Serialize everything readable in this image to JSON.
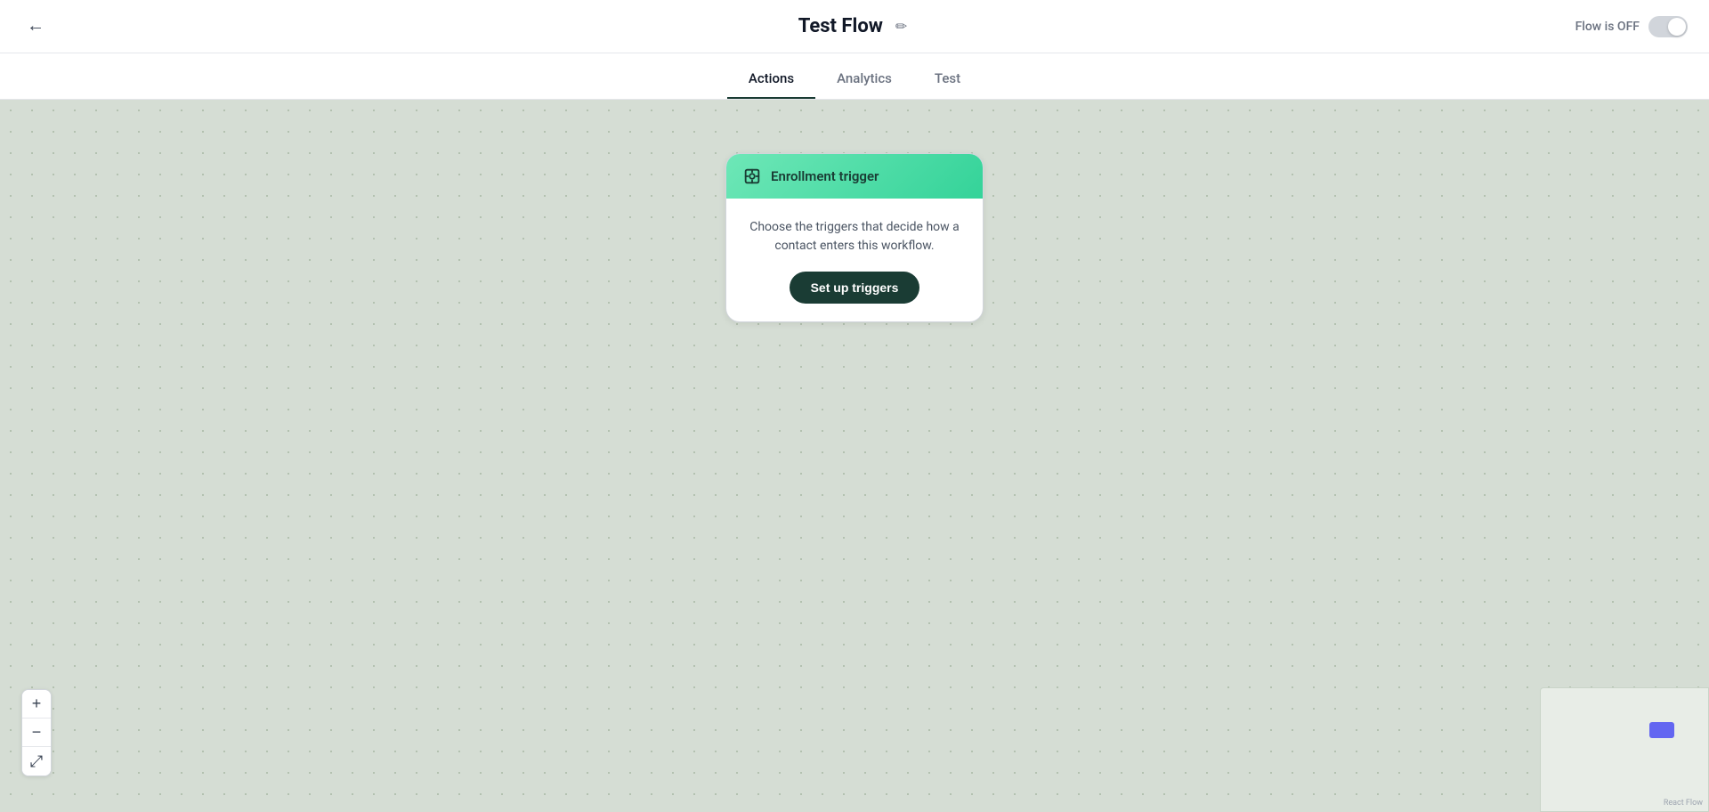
{
  "header": {
    "back_label": "←",
    "title": "Test Flow",
    "edit_icon": "✏",
    "flow_status": "Flow is OFF",
    "toggle_state": false
  },
  "tabs": {
    "items": [
      {
        "id": "actions",
        "label": "Actions",
        "active": true
      },
      {
        "id": "analytics",
        "label": "Analytics",
        "active": false
      },
      {
        "id": "test",
        "label": "Test",
        "active": false
      }
    ]
  },
  "canvas": {
    "trigger_card": {
      "title": "Enrollment trigger",
      "description_line1": "Choose the triggers that decide how",
      "description_line2": "a contact enters this workflow.",
      "description": "Choose the triggers that decide how a contact enters this workflow.",
      "button_label": "Set up triggers"
    }
  },
  "zoom": {
    "plus_label": "+",
    "minus_label": "−",
    "fit_icon": "⤢"
  },
  "minimap": {
    "react_flow_label": "React Flow"
  }
}
